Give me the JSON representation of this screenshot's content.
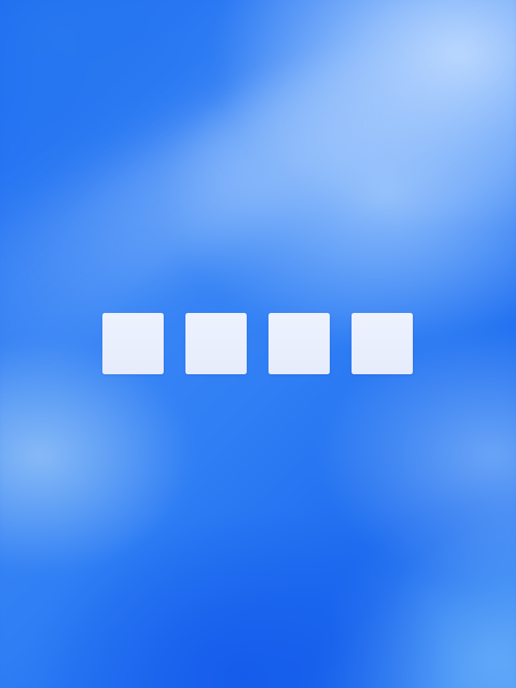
{
  "screen": {
    "type": "passcode-entry",
    "passcode_length": 4,
    "slots": [
      {
        "filled": false
      },
      {
        "filled": false
      },
      {
        "filled": false
      },
      {
        "filled": false
      }
    ]
  },
  "colors": {
    "background_primary": "#1f6cf2",
    "background_highlight": "#bedaff",
    "slot_fill": "#eef2ff"
  }
}
